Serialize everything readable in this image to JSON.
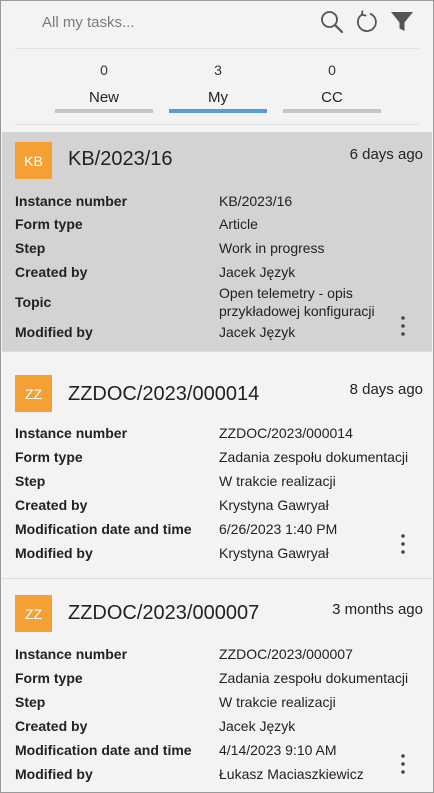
{
  "search": {
    "placeholder": "All my tasks..."
  },
  "tabs": [
    {
      "count": "0",
      "label": "New"
    },
    {
      "count": "3",
      "label": "My"
    },
    {
      "count": "0",
      "label": "CC"
    }
  ],
  "active_tab": "My",
  "colors": {
    "accent": "#5b9bd5",
    "avatar": "#f5a034",
    "selected_card": "#d3d3d3"
  },
  "cards": [
    {
      "avatar": "KB",
      "title": "KB/2023/16",
      "time": "6 days ago",
      "fields": [
        {
          "key": "Instance number",
          "value": "KB/2023/16"
        },
        {
          "key": "Form type",
          "value": "Article"
        },
        {
          "key": "Step",
          "value": "Work in progress"
        },
        {
          "key": "Created by",
          "value": "Jacek Język"
        },
        {
          "key": "Topic",
          "value": "Open telemetry - opis przykładowej konfiguracji"
        },
        {
          "key": "Modified by",
          "value": "Jacek Język"
        }
      ]
    },
    {
      "avatar": "ZZ",
      "title": "ZZDOC/2023/000014",
      "time": "8 days ago",
      "fields": [
        {
          "key": "Instance number",
          "value": "ZZDOC/2023/000014"
        },
        {
          "key": "Form type",
          "value": "Zadania zespołu dokumentacji"
        },
        {
          "key": "Step",
          "value": "W trakcie realizacji"
        },
        {
          "key": "Created by",
          "value": "Krystyna Gawryał"
        },
        {
          "key": "Modification date and time",
          "value": "6/26/2023 1:40 PM"
        },
        {
          "key": "Modified by",
          "value": "Krystyna Gawryał"
        }
      ]
    },
    {
      "avatar": "ZZ",
      "title": "ZZDOC/2023/000007",
      "time": "3 months ago",
      "fields": [
        {
          "key": "Instance number",
          "value": "ZZDOC/2023/000007"
        },
        {
          "key": "Form type",
          "value": "Zadania zespołu dokumentacji"
        },
        {
          "key": "Step",
          "value": "W trakcie realizacji"
        },
        {
          "key": "Created by",
          "value": "Jacek Język"
        },
        {
          "key": "Modification date and time",
          "value": "4/14/2023 9:10 AM"
        },
        {
          "key": "Modified by",
          "value": "Łukasz Maciaszkiewicz"
        }
      ]
    }
  ]
}
